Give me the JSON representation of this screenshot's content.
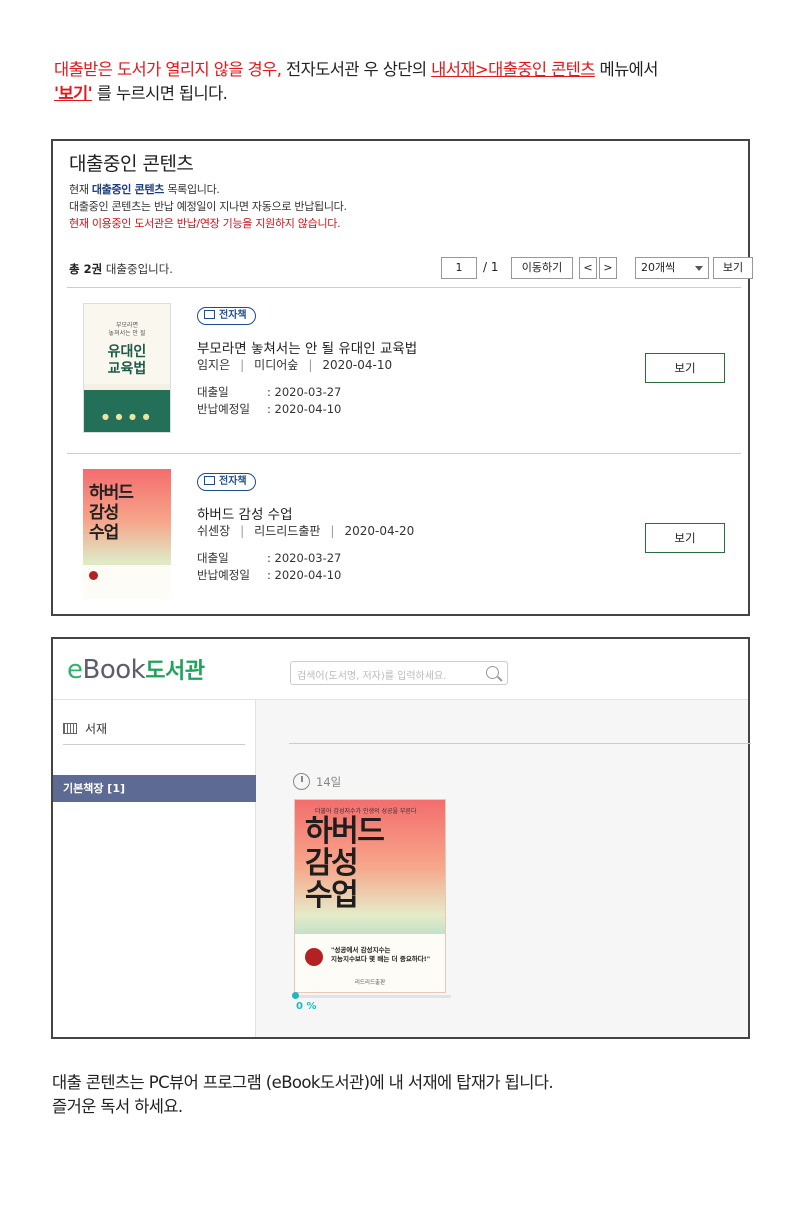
{
  "intro": {
    "part1": "대출받은 도서가 열리지 않을 경우,",
    "part2": " 전자도서관 우 상단의 ",
    "part3": "내서재>대출중인 콘텐츠",
    "part4": " 메뉴에서",
    "part5": "'보기'",
    "part6": " 를 누르시면 됩니다."
  },
  "panel1": {
    "title": "대출중인 콘텐츠",
    "notice1_a": "현재 ",
    "notice1_b": "대출중인 콘텐츠",
    "notice1_c": " 목록입니다.",
    "notice2": "대출중인 콘텐츠는 반납 예정일이 지나면 자동으로 반납됩니다.",
    "notice3": "현재 이용중인 도서관은 반납/연장 기능을 지원하지 않습니다.",
    "count_bold": "총 2권",
    "count_rest": " 대출중입니다.",
    "page_value": "1",
    "page_total": "/ 1",
    "move_button": "이동하기",
    "prev_button": "<",
    "next_button": ">",
    "per_page": "20개씩",
    "view_small_button": "보기",
    "books": [
      {
        "badge": "전자책",
        "title": "부모라면 놓쳐서는 안 될 유대인 교육법",
        "author": "임지은",
        "publisher": "미디어숲",
        "pub_date": "2020-04-10",
        "loan_label": "대출일",
        "loan_date": ": 2020-03-27",
        "due_label": "반납예정일",
        "due_date": ": 2020-04-10",
        "view_button": "보기",
        "cover_top": "부모라면\n놓쳐서는 안 될",
        "cover_title": "유대인\n교육법"
      },
      {
        "badge": "전자책",
        "title": "하버드 감성 수업",
        "author": "쉬센장",
        "publisher": "리드리드출판",
        "pub_date": "2020-04-20",
        "loan_label": "대출일",
        "loan_date": ": 2020-03-27",
        "due_label": "반납예정일",
        "due_date": ": 2020-04-10",
        "view_button": "보기",
        "cover_title": "하버드\n감성\n수업"
      }
    ]
  },
  "panel2": {
    "logo_e": "e",
    "logo_book": "Book",
    "logo_lib": "도서관",
    "search_placeholder": "검색어(도서명, 저자)를 입력하세요.",
    "side_title": "서재",
    "shelf_item": "기본책장 [1]",
    "days_left": "14일",
    "cover_tag": "더불어 감성지수가 인생의 성공을 부른다",
    "cover_title": "하버드\n감성\n수업",
    "cover_quote": "\"성공에서 감성지수는\n지능지수보다 몇 배는 더 중요하다!\"",
    "cover_publisher": "리드리드출판",
    "progress": "0 %",
    "progress_fraction": 0
  },
  "outro": {
    "line1": "대출 콘텐츠는 PC뷰어 프로그램 (eBook도서관)에 내 서재에 탑재가 됩니다.",
    "line2": "즐거운 독서 하세요."
  },
  "colors": {
    "accent_red": "#e0191e",
    "navy": "#1d3e7d",
    "brand_green": "#1fa35c",
    "shelf_active": "#5d6b94",
    "progress_teal": "#1fb8c0"
  }
}
